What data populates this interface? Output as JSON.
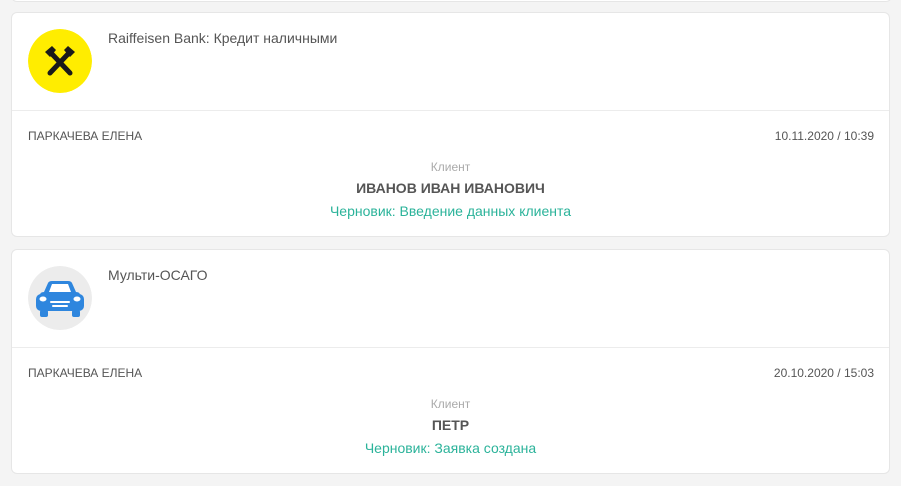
{
  "cards": [
    {
      "logo_icon": "raiffeisen-logo-icon",
      "logo_color": "#ffed00",
      "product": "Raiffeisen Bank: Кредит наличными",
      "agent": "ПАРКАЧЕВА ЕЛЕНА",
      "datetime": "10.11.2020 / 10:39",
      "client_label": "Клиент",
      "client_name": "ИВАНОВ ИВАН ИВАНОВИЧ",
      "status": "Черновик: Введение данных клиента"
    },
    {
      "logo_icon": "car-icon",
      "logo_color": "#2e86de",
      "product": "Мульти-ОСАГО",
      "agent": "ПАРКАЧЕВА ЕЛЕНА",
      "datetime": "20.10.2020 / 15:03",
      "client_label": "Клиент",
      "client_name": "ПЕТР",
      "status": "Черновик: Заявка создана"
    }
  ],
  "colors": {
    "status": "#2bb39a",
    "text": "#555555",
    "muted": "#aaaaaa"
  }
}
